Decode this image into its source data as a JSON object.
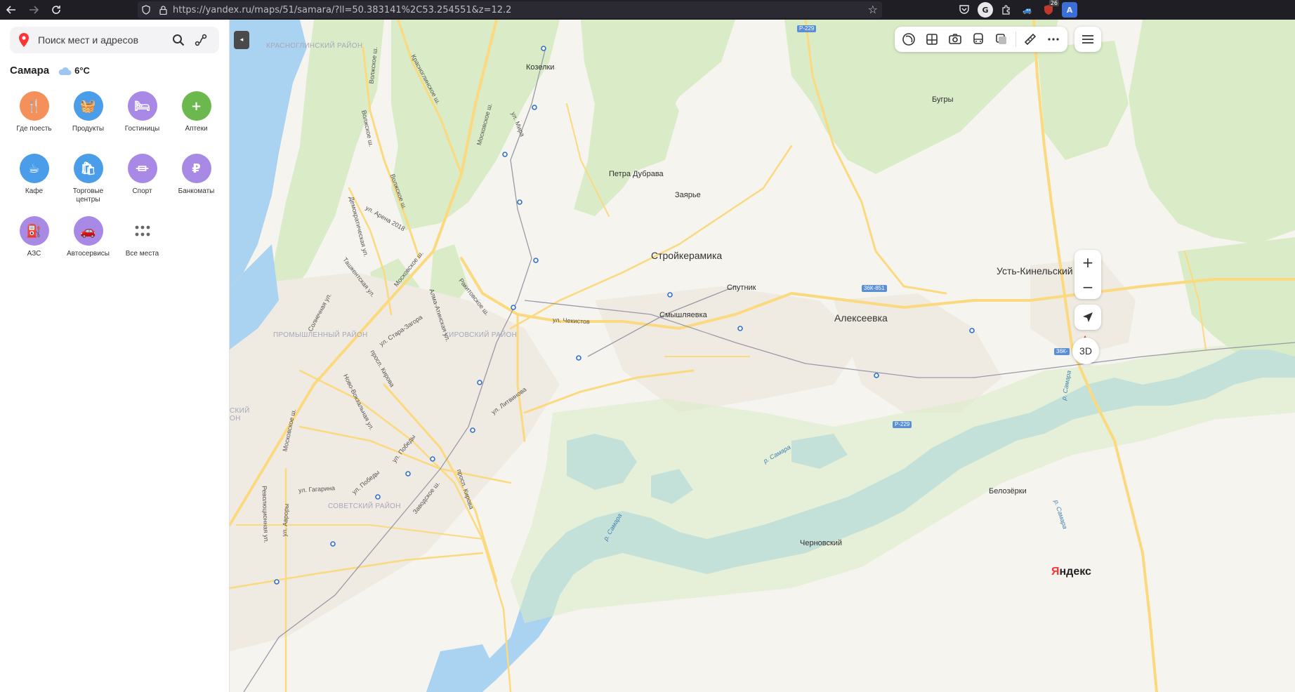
{
  "browser": {
    "back_icon": "arrow-left-icon",
    "forward_icon": "arrow-right-icon",
    "reload_icon": "reload-icon",
    "url": "https://yandex.ru/maps/51/samara/?ll=50.383141%2C53.254551&z=12.2",
    "extension_badge": "26"
  },
  "sidebar": {
    "search_placeholder": "Поиск мест и адресов",
    "city_name": "Самара",
    "temperature": "6°C",
    "categories": [
      {
        "label": "Где поесть",
        "color": "#f6905a",
        "icon": "fork-knife-icon",
        "glyph": "🍴"
      },
      {
        "label": "Продукты",
        "color": "#4a9de8",
        "icon": "basket-icon",
        "glyph": "🧺"
      },
      {
        "label": "Гостиницы",
        "color": "#a889e6",
        "icon": "bed-icon",
        "glyph": "🛏"
      },
      {
        "label": "Аптеки",
        "color": "#6ab84e",
        "icon": "pharmacy-icon",
        "glyph": "+"
      },
      {
        "label": "Кафе",
        "color": "#4a9de8",
        "icon": "coffee-cup-icon",
        "glyph": "☕"
      },
      {
        "label": "Торговые центры",
        "color": "#4a9de8",
        "icon": "shopping-bag-icon",
        "glyph": "🛍"
      },
      {
        "label": "Спорт",
        "color": "#a889e6",
        "icon": "dumbbell-icon",
        "glyph": "⏛"
      },
      {
        "label": "Банкоматы",
        "color": "#a889e6",
        "icon": "ruble-icon",
        "glyph": "₽"
      },
      {
        "label": "АЗС",
        "color": "#a889e6",
        "icon": "fuel-pump-icon",
        "glyph": "⛽"
      },
      {
        "label": "Автосервисы",
        "color": "#a889e6",
        "icon": "car-service-icon",
        "glyph": "🚗"
      },
      {
        "label": "Все места",
        "color": "#ffffff",
        "icon": "grid-dots-icon",
        "glyph": "⋯"
      }
    ]
  },
  "map": {
    "labels": {
      "krasnoglinsky": "КРАСНОГЛИНСКИЙ РАЙОН",
      "kozelki": "Козелки",
      "bugry": "Бугры",
      "petra_dubrava": "Петра Дубрава",
      "zayarye": "Заярье",
      "stroykeramika": "Стройкерамика",
      "sputnik": "Спутник",
      "smyshlyaevka": "Смышляевка",
      "alekseevka": "Алексеевка",
      "ust_kinelsky": "Усть-Кинельский",
      "promyshlenny": "ПРОМЫШЛЕННЫЙ РАЙОН",
      "kirovsky": "КИРОВСКИЙ РАЙОН",
      "sovetsky": "СОВЕТСКИЙ РАЙОН",
      "kuibyshevsky_partial": "СКИЙ\nОН",
      "belozerki": "Белозёрки",
      "chernovsky": "Черновский",
      "r229_north": "Р-229",
      "r229_south": "Р-229",
      "k851": "36К-851",
      "k_east": "36К-",
      "streets": {
        "volzhskoe1": "Волжское ш.",
        "volzhskoe2": "Волжское ш.",
        "volzhskoe3": "Волжское ш.",
        "krasnoglinskoe": "Красноглинское ш.",
        "moskovskoe1": "Московское ш.",
        "moskovskoe2": "Московское ш.",
        "moskovskoe3": "Московское ш.",
        "ul_mira": "ул. Мира",
        "demokraticheskaya": "Демократическая ул.",
        "arena": "ул. Арена 2018",
        "tashkentskaya": "Ташкентская ул.",
        "solnechnaya": "Солнечная ул.",
        "rakitovskoe": "Ракитовское ш.",
        "alma_atinskaya": "Алма-Атинская ул.",
        "stara_zagora": "ул. Стара-Загора",
        "chekistov": "ул. Чекистов",
        "kirova1": "просп. Кирова",
        "kirova2": "просп. Кирова",
        "novo_vokzalnaya": "Ново-Вокзальная ул.",
        "litvinova": "ул. Литвинова",
        "pobedy1": "ул. Победы",
        "pobedy2": "ул. Победы",
        "zavodskoe": "Заводское ш.",
        "gagarina": "ул. Гагарина",
        "revolyutsionnaya": "Революционная ул.",
        "avrory": "ул. Авроры"
      },
      "rivers": {
        "samara1": "р. Самара",
        "samara2": "р. Самара",
        "samara3": "р. Самара",
        "samara4": "р. Самара"
      }
    },
    "toolbar": [
      "layers-icon",
      "panorama-icon",
      "camera-icon",
      "bus-icon",
      "layers-stack-icon",
      "ruler-icon",
      "more-dots-icon"
    ],
    "zoom_in": "+",
    "zoom_out": "−",
    "btn_3d": "3D",
    "logo": "Яндекс",
    "colors": {
      "land": "#f6f4ee",
      "forest": "#d9ecc7",
      "water": "#a9d3f0",
      "road": "#fbd97f",
      "urban": "#efece6"
    }
  }
}
